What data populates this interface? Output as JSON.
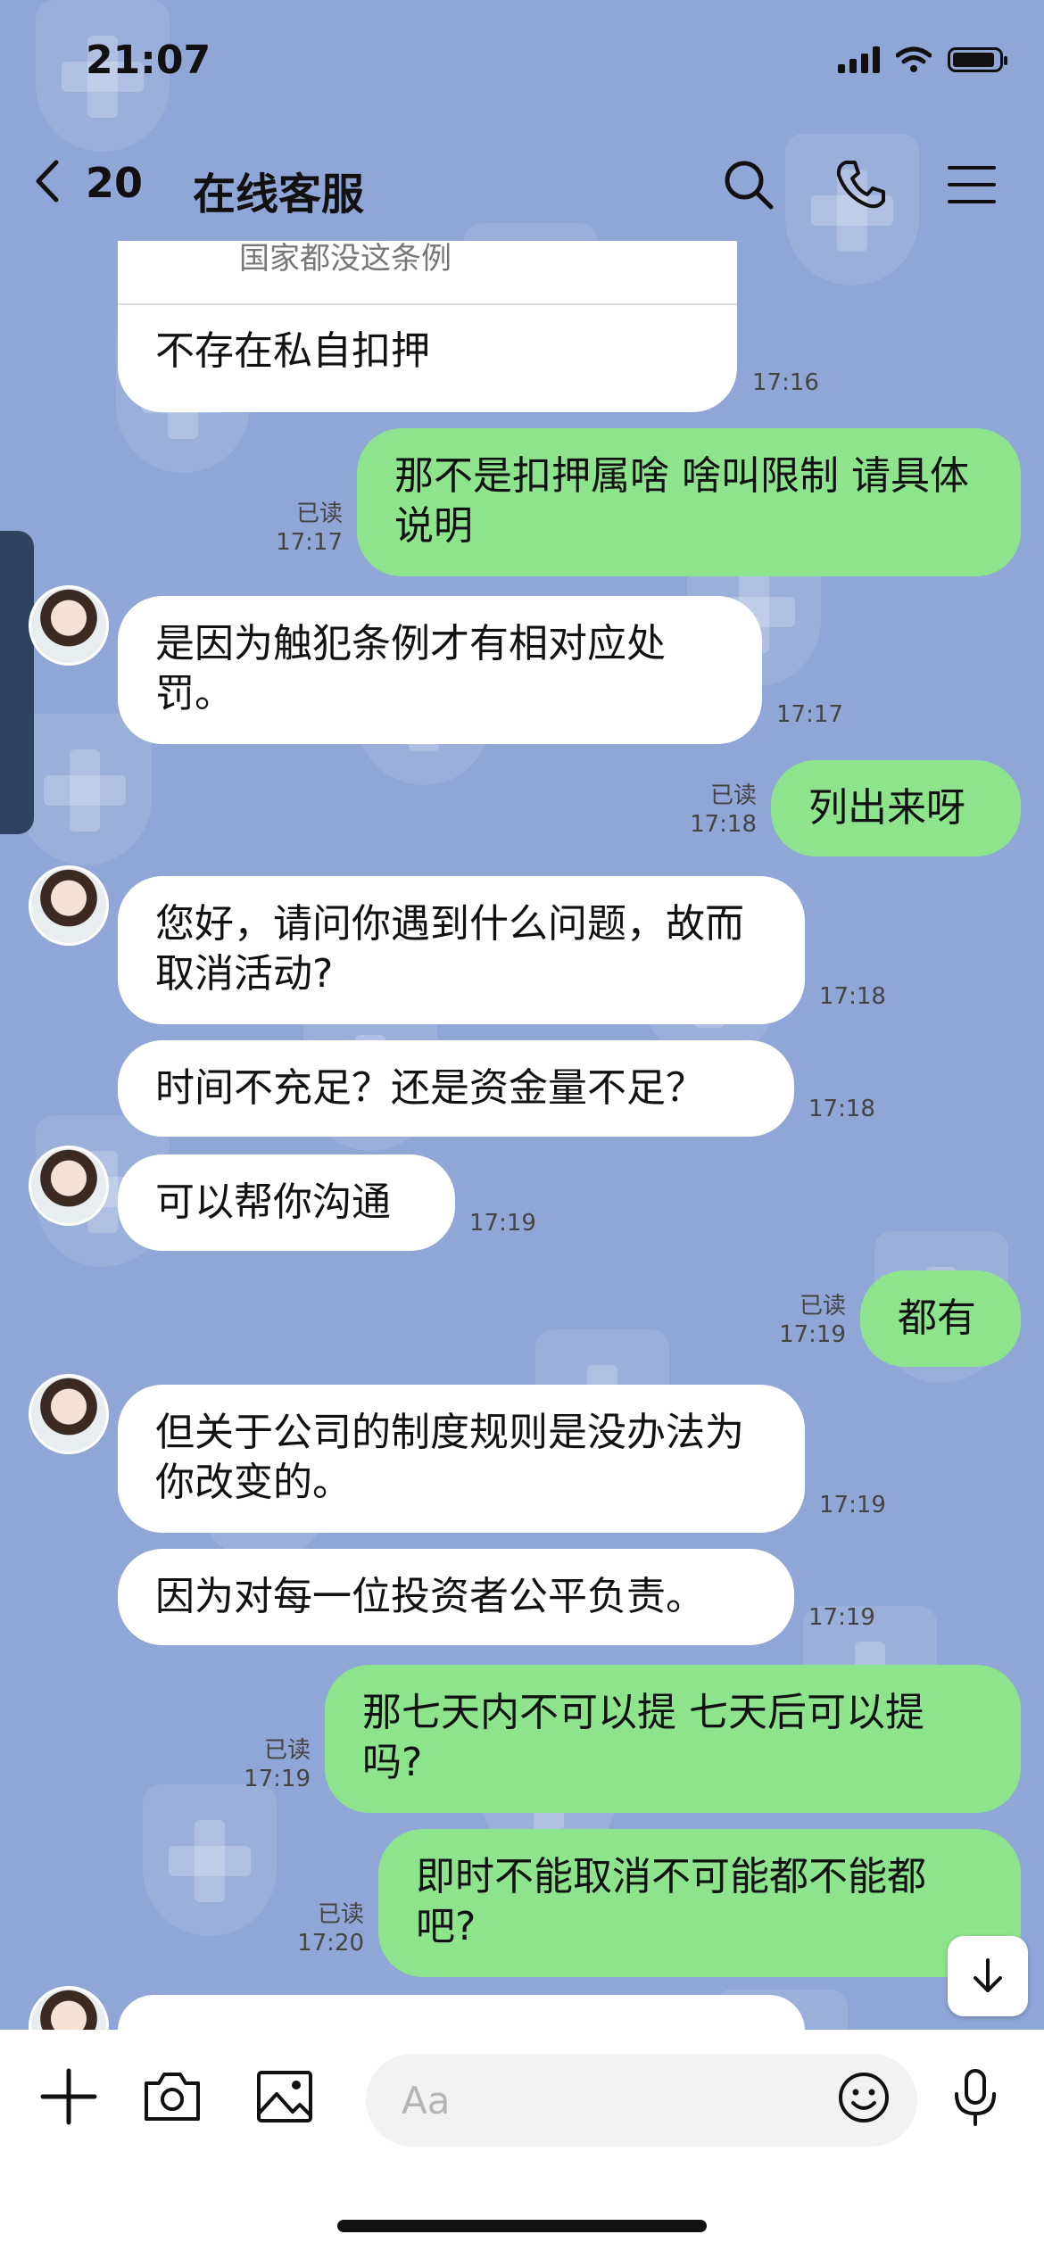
{
  "status_bar": {
    "time": "21:07"
  },
  "header": {
    "unread_count": "20",
    "title": "在线客服"
  },
  "quoted_message": "国家都没这条例",
  "messages": [
    {
      "side": "in",
      "text": "不存在私自扣押",
      "time": "17:16"
    },
    {
      "side": "out",
      "text": "那不是扣押属啥 啥叫限制 请具体说明",
      "read": "已读",
      "time": "17:17"
    },
    {
      "side": "in",
      "text": "是因为触犯条例才有相对应处罚。",
      "time": "17:17"
    },
    {
      "side": "out",
      "text": "列出来呀",
      "read": "已读",
      "time": "17:18"
    },
    {
      "side": "in",
      "text": "您好，请问你遇到什么问题，故而取消活动?",
      "time": "17:18"
    },
    {
      "side": "in",
      "text": "时间不充足？还是资金量不足？",
      "time": "17:18"
    },
    {
      "side": "in",
      "text": "可以帮你沟通",
      "time": "17:19"
    },
    {
      "side": "out",
      "text": "都有",
      "read": "已读",
      "time": "17:19"
    },
    {
      "side": "in",
      "text": "但关于公司的制度规则是没办法为你改变的。",
      "time": "17:19"
    },
    {
      "side": "in",
      "text": "因为对每一位投资者公平负责。",
      "time": "17:19"
    },
    {
      "side": "out",
      "text": "那七天内不可以提 七天后可以提吗?",
      "read": "已读",
      "time": "17:19"
    },
    {
      "side": "out",
      "text": "即时不能取消不可能都不能都吧?",
      "read": "已读",
      "time": "17:20"
    }
  ],
  "input": {
    "placeholder": "Aa"
  }
}
